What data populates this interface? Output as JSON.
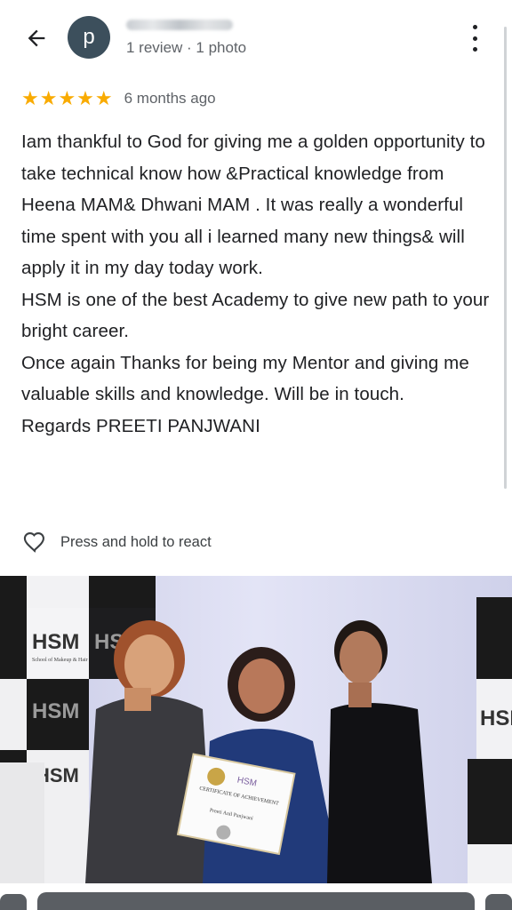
{
  "header": {
    "avatar_letter": "p",
    "reviewer_meta": "1 review · 1 photo",
    "icons": {
      "back": "arrow-left-icon",
      "menu": "more-vertical-icon"
    }
  },
  "review": {
    "rating": 5,
    "stars": "★★★★★",
    "date": "6 months ago",
    "paragraphs": [
      "Iam thankful to God for giving me a golden opportunity to take technical know how &Practical knowledge from Heena MAM& Dhwani MAM . It was really a wonderful time spent with you all i learned many new things& will apply it in my day today work.",
      "HSM is one of the best Academy to give new path to your bright career.",
      "Once again Thanks for being my Mentor and giving me valuable skills and knowledge. Will be in touch.",
      "Regards PREETI PANJWANI"
    ]
  },
  "react": {
    "label": "Press and hold to react",
    "icon": "heart-outline-icon"
  },
  "photo": {
    "backdrop_brand": "HSM",
    "backdrop_tagline": "School of Makeup & Hair",
    "certificate_title": "CERTIFICATE OF ACHIEVEMENT",
    "certificate_name": "Preeti Anil Panjwani"
  },
  "colors": {
    "star": "#f9ab00",
    "avatar": "#3c4f5c",
    "text": "#202124",
    "muted": "#5f6368"
  }
}
